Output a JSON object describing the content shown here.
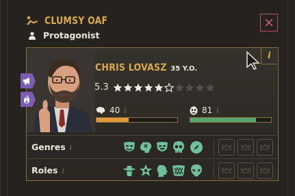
{
  "header": {
    "trait_name": "CLUMSY OAF",
    "role_name": "Protagonist",
    "trait_icon": "fallen-figure-icon",
    "role_icon": "person-icon",
    "close_icon": "close-icon"
  },
  "character": {
    "name": "CHRIS LOVASZ",
    "age": "35 Y.O.",
    "rating": "5.3",
    "stars": {
      "total": 10,
      "filled": 5,
      "half": 1
    },
    "info_label": "i"
  },
  "stats": [
    {
      "icon": "brain-icon",
      "value": "40",
      "info": "i",
      "fill": 0.4,
      "color": "#e09a3a"
    },
    {
      "icon": "face-mask-icon",
      "value": "81",
      "info": "i",
      "fill": 0.81,
      "color": "#58a574"
    }
  ],
  "side_tabs": [
    {
      "icon": "megaphone-icon"
    },
    {
      "icon": "flame-icon"
    }
  ],
  "rows": [
    {
      "label": "Genres",
      "info": "i",
      "icons": [
        "comedy-mask-icon",
        "brain-puzzle-icon",
        "smile-mask-icon",
        "skull-icon",
        "compass-icon"
      ],
      "empty_slots": 3
    },
    {
      "label": "Roles",
      "info": "i",
      "icons": [
        "cowboy-icon",
        "sheriff-star-icon",
        "profile-head-icon",
        "jaws-icon",
        "alien-icon"
      ],
      "empty_slots": 3
    }
  ],
  "colors": {
    "accent_gold": "#d9a94f",
    "close_red": "#b3545f",
    "tab_purple": "#7d5cb3",
    "tag_green": "#6fc19a"
  }
}
